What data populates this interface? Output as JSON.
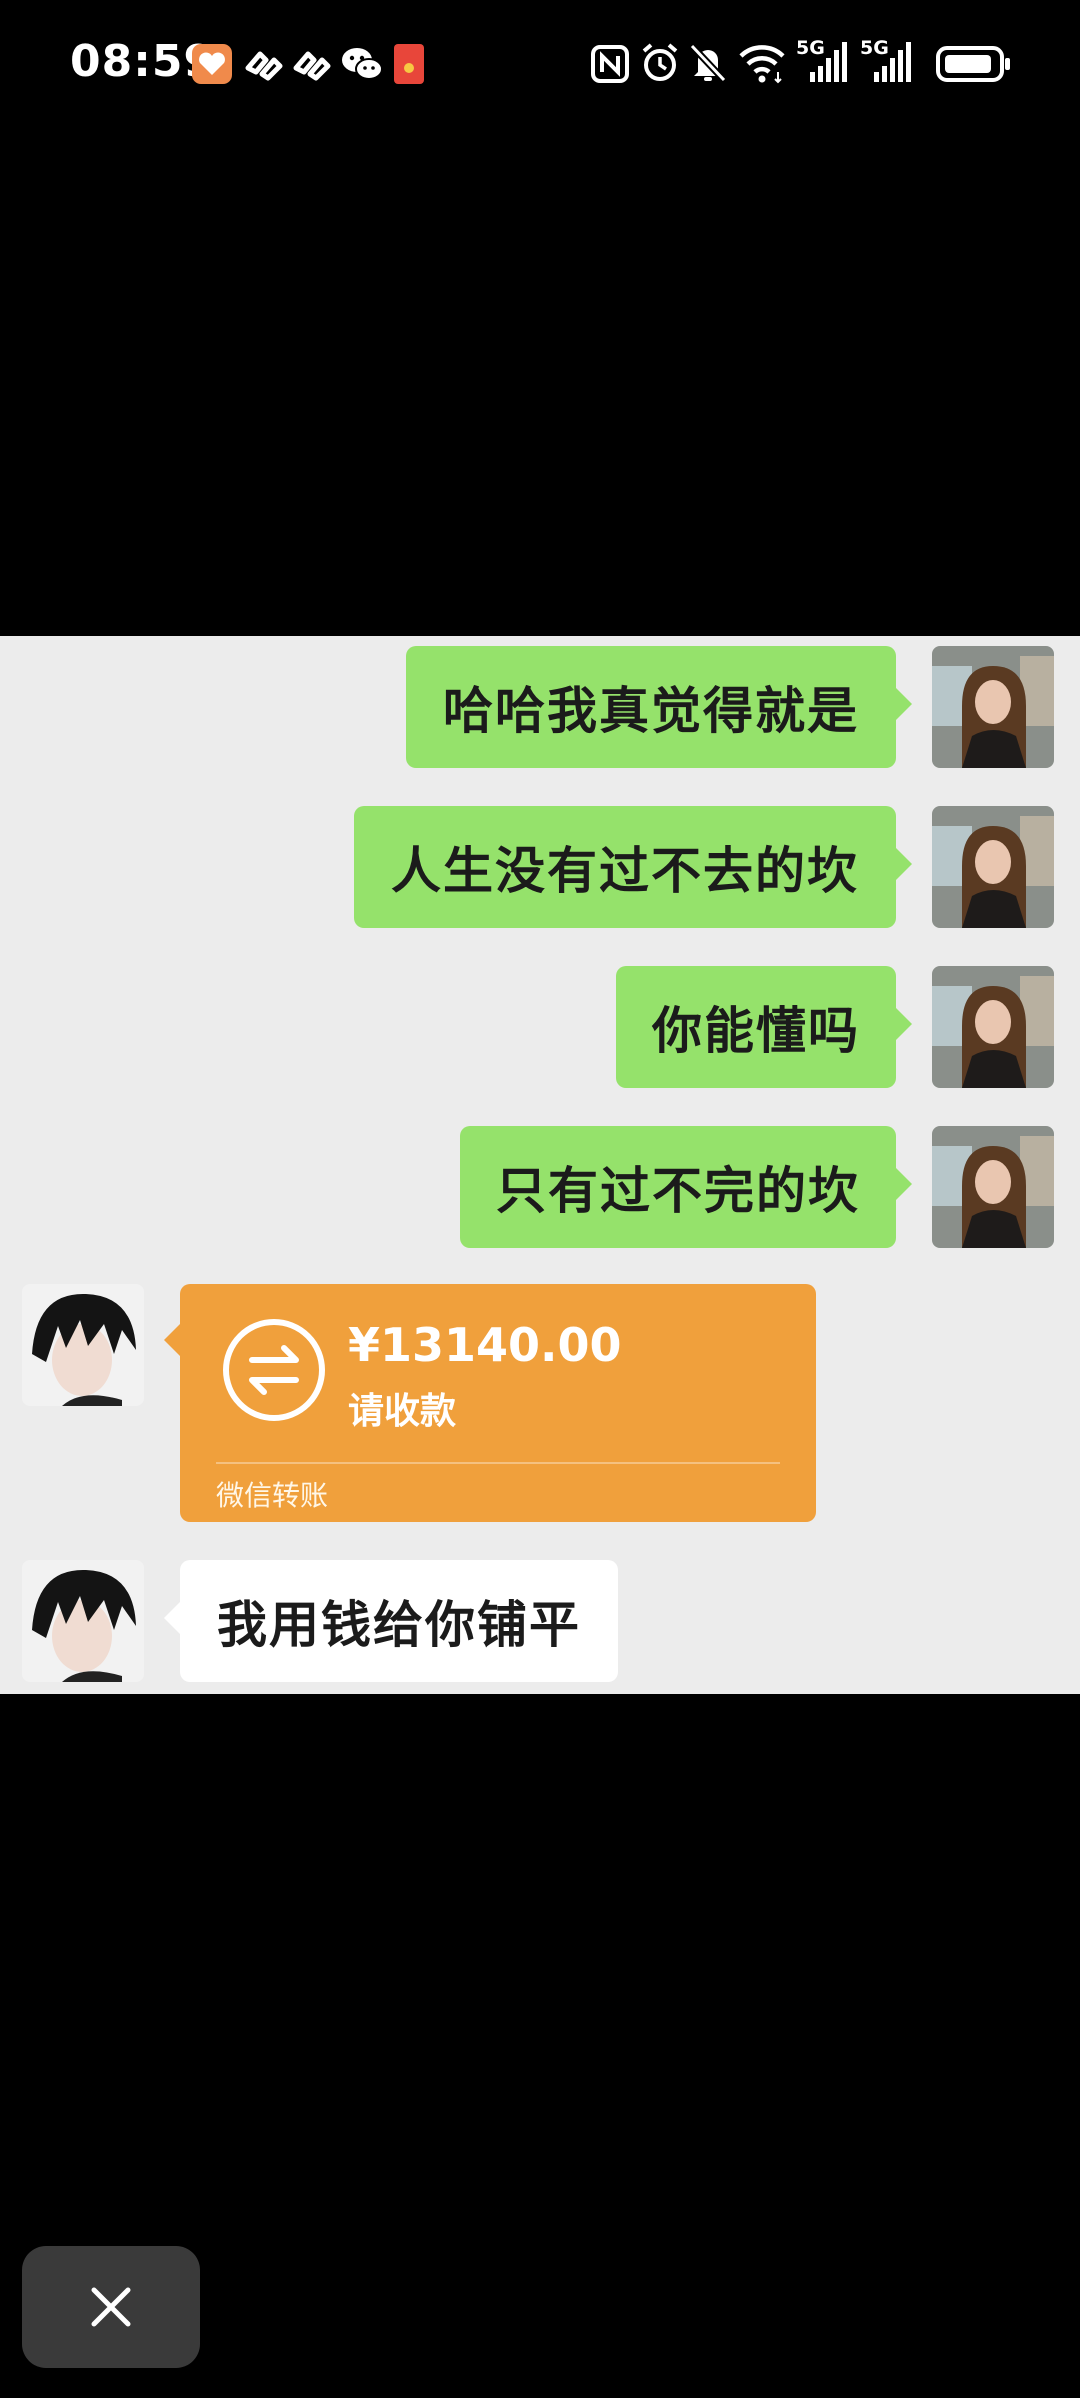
{
  "status_bar": {
    "time": "08:59",
    "left_icons": [
      "heart-app-icon",
      "link-app-icon",
      "link-app-icon",
      "wechat-icon",
      "red-packet-icon"
    ],
    "right_icons": [
      "nfc-icon",
      "alarm-icon",
      "mute-icon",
      "wifi-icon",
      "signal-icon",
      "signal-icon",
      "battery-icon"
    ],
    "network_label_1": "5G",
    "network_label_2": "5G"
  },
  "chat": {
    "messages_sent": [
      {
        "text": "哈哈我真觉得就是"
      },
      {
        "text": "人生没有过不去的坎"
      },
      {
        "text": "你能懂吗"
      },
      {
        "text": "只有过不完的坎"
      }
    ],
    "transfer": {
      "amount": "¥13140.00",
      "action": "请收款",
      "footer": "微信转账",
      "color": "#f0a03c"
    },
    "message_received": {
      "text": "我用钱给你铺平"
    }
  },
  "colors": {
    "sent_bubble": "#95e26b",
    "received_bubble": "#ffffff",
    "chat_background": "#ececec"
  },
  "close_button": {
    "icon": "close-icon"
  }
}
